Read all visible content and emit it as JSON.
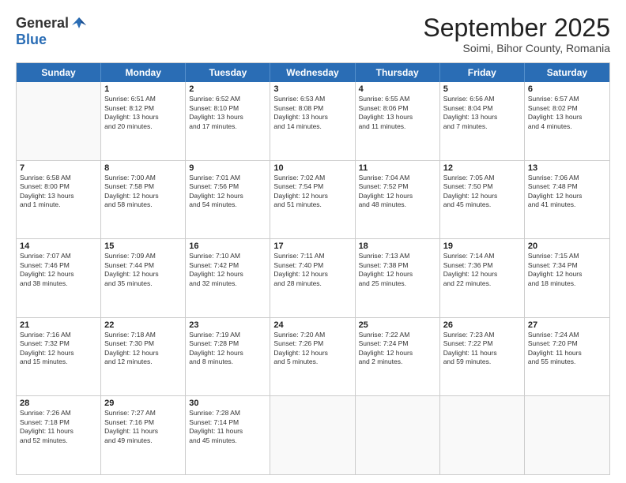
{
  "header": {
    "logo_general": "General",
    "logo_blue": "Blue",
    "month_title": "September 2025",
    "subtitle": "Soimi, Bihor County, Romania"
  },
  "calendar": {
    "days_of_week": [
      "Sunday",
      "Monday",
      "Tuesday",
      "Wednesday",
      "Thursday",
      "Friday",
      "Saturday"
    ],
    "rows": [
      [
        {
          "day": "",
          "info": ""
        },
        {
          "day": "1",
          "info": "Sunrise: 6:51 AM\nSunset: 8:12 PM\nDaylight: 13 hours\nand 20 minutes."
        },
        {
          "day": "2",
          "info": "Sunrise: 6:52 AM\nSunset: 8:10 PM\nDaylight: 13 hours\nand 17 minutes."
        },
        {
          "day": "3",
          "info": "Sunrise: 6:53 AM\nSunset: 8:08 PM\nDaylight: 13 hours\nand 14 minutes."
        },
        {
          "day": "4",
          "info": "Sunrise: 6:55 AM\nSunset: 8:06 PM\nDaylight: 13 hours\nand 11 minutes."
        },
        {
          "day": "5",
          "info": "Sunrise: 6:56 AM\nSunset: 8:04 PM\nDaylight: 13 hours\nand 7 minutes."
        },
        {
          "day": "6",
          "info": "Sunrise: 6:57 AM\nSunset: 8:02 PM\nDaylight: 13 hours\nand 4 minutes."
        }
      ],
      [
        {
          "day": "7",
          "info": "Sunrise: 6:58 AM\nSunset: 8:00 PM\nDaylight: 13 hours\nand 1 minute."
        },
        {
          "day": "8",
          "info": "Sunrise: 7:00 AM\nSunset: 7:58 PM\nDaylight: 12 hours\nand 58 minutes."
        },
        {
          "day": "9",
          "info": "Sunrise: 7:01 AM\nSunset: 7:56 PM\nDaylight: 12 hours\nand 54 minutes."
        },
        {
          "day": "10",
          "info": "Sunrise: 7:02 AM\nSunset: 7:54 PM\nDaylight: 12 hours\nand 51 minutes."
        },
        {
          "day": "11",
          "info": "Sunrise: 7:04 AM\nSunset: 7:52 PM\nDaylight: 12 hours\nand 48 minutes."
        },
        {
          "day": "12",
          "info": "Sunrise: 7:05 AM\nSunset: 7:50 PM\nDaylight: 12 hours\nand 45 minutes."
        },
        {
          "day": "13",
          "info": "Sunrise: 7:06 AM\nSunset: 7:48 PM\nDaylight: 12 hours\nand 41 minutes."
        }
      ],
      [
        {
          "day": "14",
          "info": "Sunrise: 7:07 AM\nSunset: 7:46 PM\nDaylight: 12 hours\nand 38 minutes."
        },
        {
          "day": "15",
          "info": "Sunrise: 7:09 AM\nSunset: 7:44 PM\nDaylight: 12 hours\nand 35 minutes."
        },
        {
          "day": "16",
          "info": "Sunrise: 7:10 AM\nSunset: 7:42 PM\nDaylight: 12 hours\nand 32 minutes."
        },
        {
          "day": "17",
          "info": "Sunrise: 7:11 AM\nSunset: 7:40 PM\nDaylight: 12 hours\nand 28 minutes."
        },
        {
          "day": "18",
          "info": "Sunrise: 7:13 AM\nSunset: 7:38 PM\nDaylight: 12 hours\nand 25 minutes."
        },
        {
          "day": "19",
          "info": "Sunrise: 7:14 AM\nSunset: 7:36 PM\nDaylight: 12 hours\nand 22 minutes."
        },
        {
          "day": "20",
          "info": "Sunrise: 7:15 AM\nSunset: 7:34 PM\nDaylight: 12 hours\nand 18 minutes."
        }
      ],
      [
        {
          "day": "21",
          "info": "Sunrise: 7:16 AM\nSunset: 7:32 PM\nDaylight: 12 hours\nand 15 minutes."
        },
        {
          "day": "22",
          "info": "Sunrise: 7:18 AM\nSunset: 7:30 PM\nDaylight: 12 hours\nand 12 minutes."
        },
        {
          "day": "23",
          "info": "Sunrise: 7:19 AM\nSunset: 7:28 PM\nDaylight: 12 hours\nand 8 minutes."
        },
        {
          "day": "24",
          "info": "Sunrise: 7:20 AM\nSunset: 7:26 PM\nDaylight: 12 hours\nand 5 minutes."
        },
        {
          "day": "25",
          "info": "Sunrise: 7:22 AM\nSunset: 7:24 PM\nDaylight: 12 hours\nand 2 minutes."
        },
        {
          "day": "26",
          "info": "Sunrise: 7:23 AM\nSunset: 7:22 PM\nDaylight: 11 hours\nand 59 minutes."
        },
        {
          "day": "27",
          "info": "Sunrise: 7:24 AM\nSunset: 7:20 PM\nDaylight: 11 hours\nand 55 minutes."
        }
      ],
      [
        {
          "day": "28",
          "info": "Sunrise: 7:26 AM\nSunset: 7:18 PM\nDaylight: 11 hours\nand 52 minutes."
        },
        {
          "day": "29",
          "info": "Sunrise: 7:27 AM\nSunset: 7:16 PM\nDaylight: 11 hours\nand 49 minutes."
        },
        {
          "day": "30",
          "info": "Sunrise: 7:28 AM\nSunset: 7:14 PM\nDaylight: 11 hours\nand 45 minutes."
        },
        {
          "day": "",
          "info": ""
        },
        {
          "day": "",
          "info": ""
        },
        {
          "day": "",
          "info": ""
        },
        {
          "day": "",
          "info": ""
        }
      ]
    ]
  }
}
